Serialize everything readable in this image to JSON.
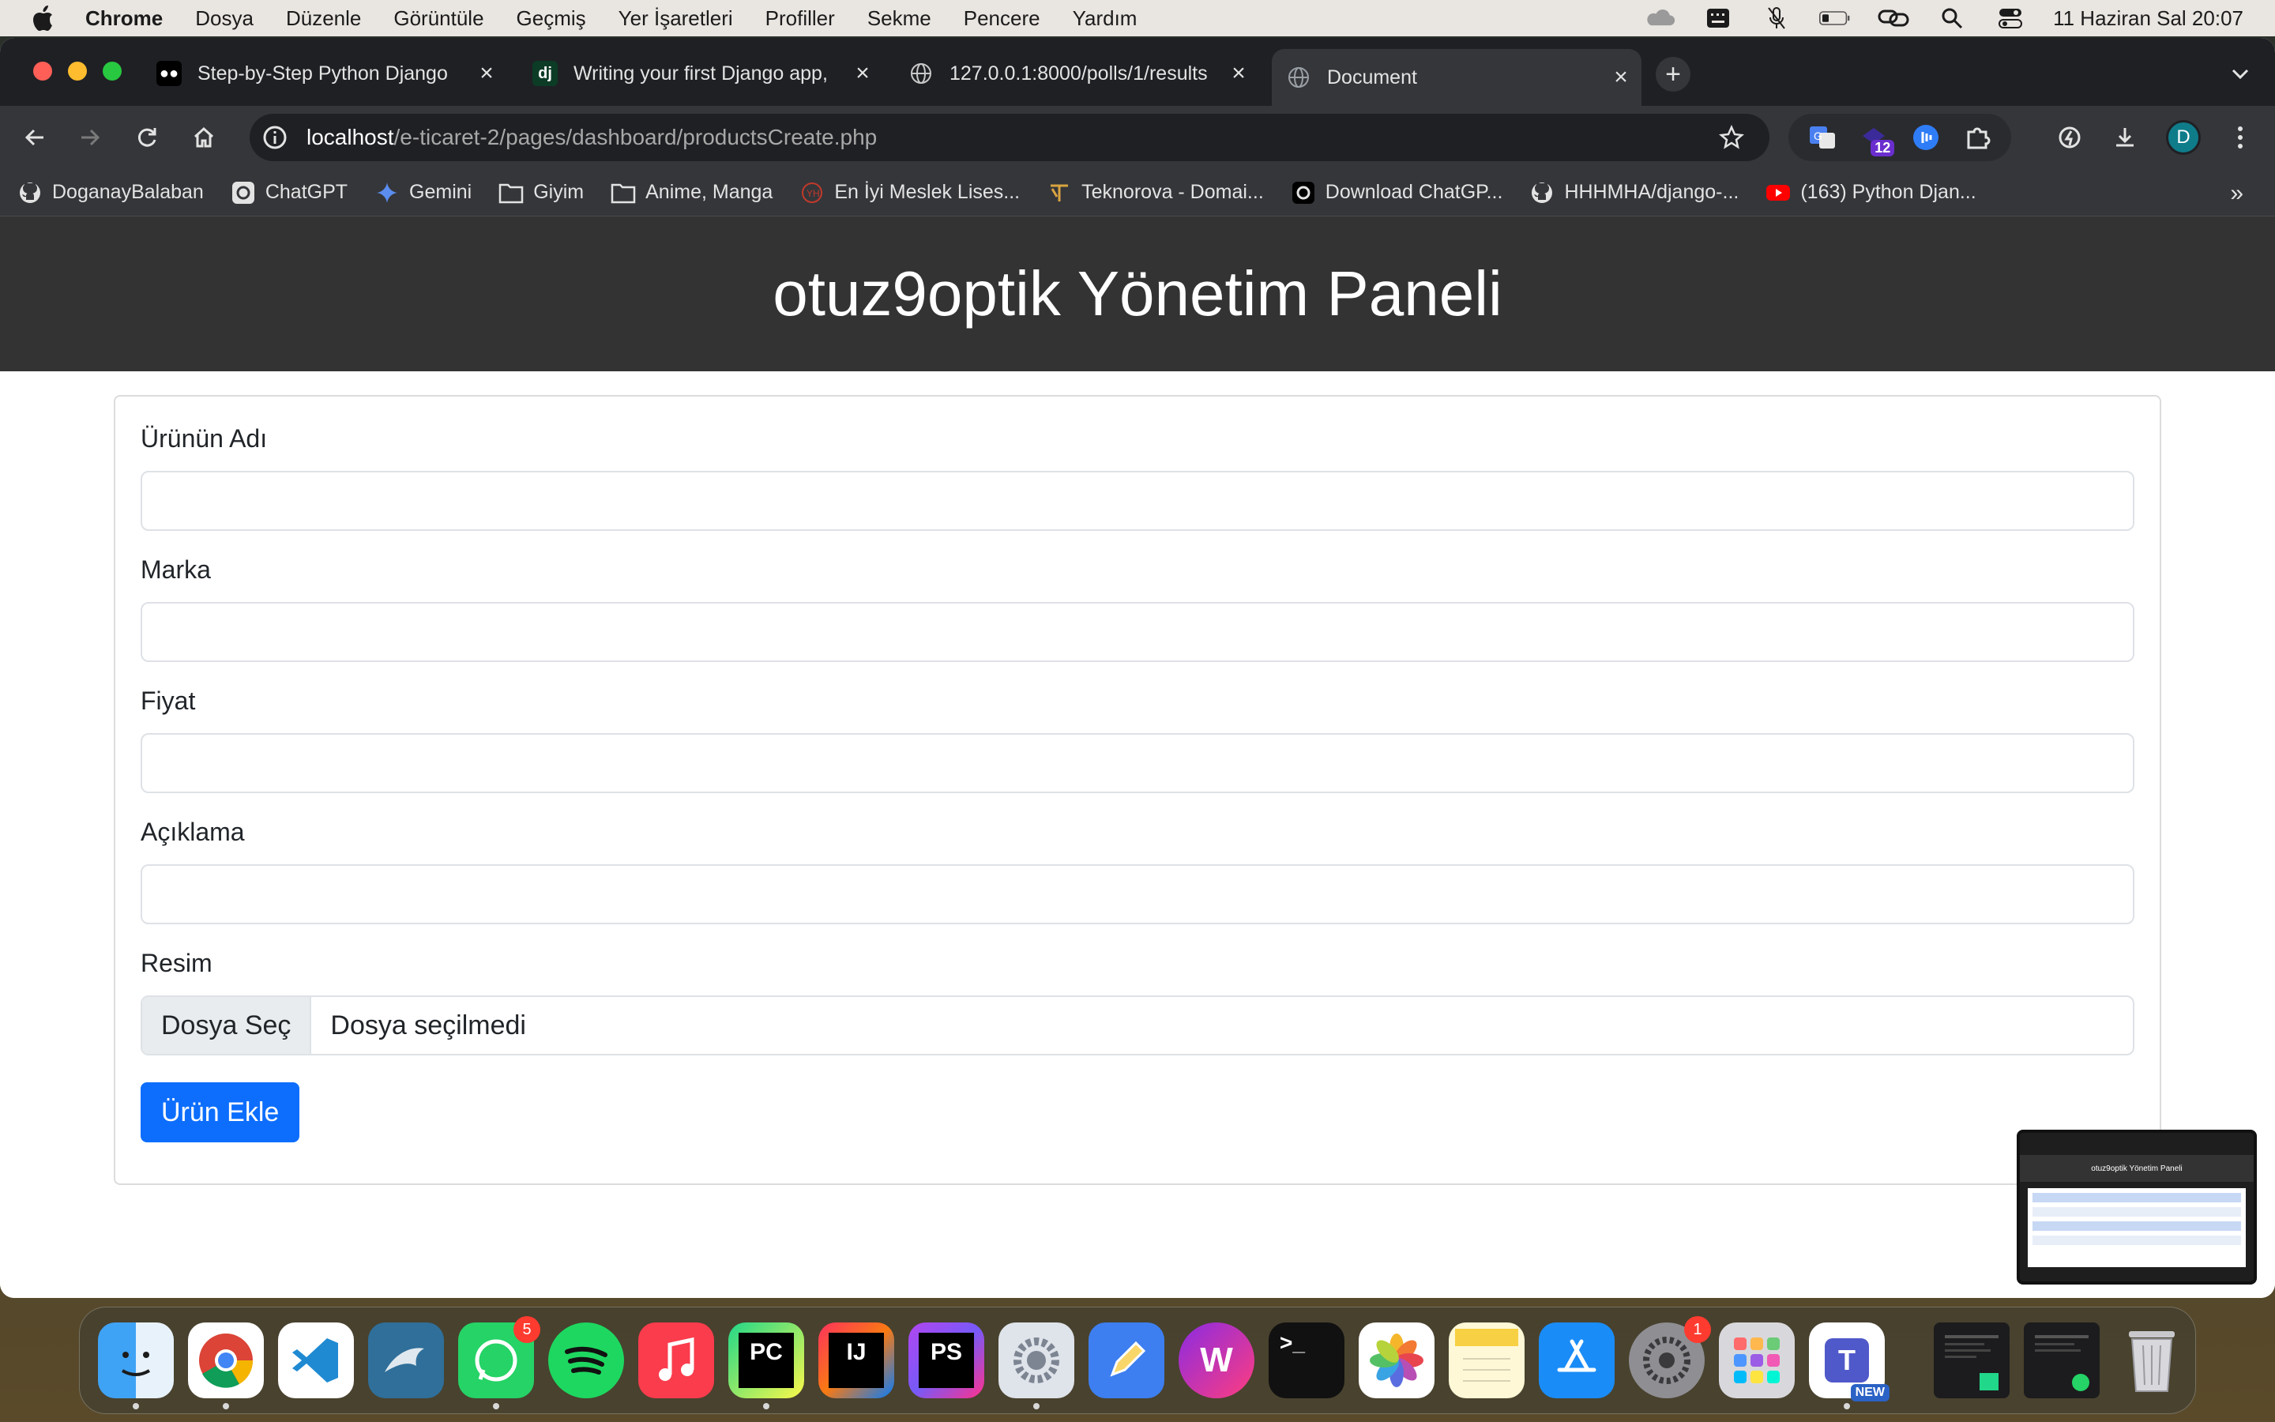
{
  "menubar": {
    "app_name": "Chrome",
    "items": [
      "Dosya",
      "Düzenle",
      "Görüntüle",
      "Geçmiş",
      "Yer İşaretleri",
      "Profiller",
      "Sekme",
      "Pencere",
      "Yardım"
    ],
    "clock": "11 Haziran Sal  20:07"
  },
  "tabs": [
    {
      "title": "Step-by-Step Python Django",
      "favicon": "medium-icon"
    },
    {
      "title": "Writing your first Django app,",
      "favicon": "django-icon"
    },
    {
      "title": "127.0.0.1:8000/polls/1/results",
      "favicon": "globe-icon"
    },
    {
      "title": "Document",
      "favicon": "globe-icon",
      "active": true
    }
  ],
  "address": {
    "host": "localhost",
    "path": "/e-ticaret-2/pages/dashboard/productsCreate.php"
  },
  "extensions": {
    "badge": "12"
  },
  "profile": {
    "initial": "D"
  },
  "bookmarks": [
    {
      "label": "DoganayBalaban",
      "icon": "github-icon"
    },
    {
      "label": "ChatGPT",
      "icon": "chatgpt-icon"
    },
    {
      "label": "Gemini",
      "icon": "gemini-icon"
    },
    {
      "label": "Giyim",
      "icon": "folder-icon"
    },
    {
      "label": "Anime, Manga",
      "icon": "folder-icon"
    },
    {
      "label": "En İyi Meslek Lises...",
      "icon": "site-icon"
    },
    {
      "label": "Teknorova - Domai...",
      "icon": "site-icon"
    },
    {
      "label": "Download ChatGP...",
      "icon": "chatgpt-icon"
    },
    {
      "label": "HHHMHA/django-...",
      "icon": "github-icon"
    },
    {
      "label": "(163) Python Djan...",
      "icon": "youtube-icon"
    }
  ],
  "page": {
    "header_title": "otuz9optik Yönetim Paneli",
    "form": {
      "name_label": "Ürünün Adı",
      "name_value": "",
      "brand_label": "Marka",
      "brand_value": "",
      "price_label": "Fiyat",
      "price_value": "",
      "description_label": "Açıklama",
      "description_value": "",
      "image_label": "Resim",
      "file_button": "Dosya Seç",
      "file_status": "Dosya seçilmedi",
      "submit_label": "Ürün Ekle"
    }
  },
  "pip": {
    "title": "otuz9optik Yönetim Paneli"
  },
  "dock": {
    "whatsapp_badge": "5",
    "settings_badge": "1",
    "teams_tag": "NEW"
  },
  "colors": {
    "header_bg": "#333333",
    "primary": "#0d6efd",
    "tab_bg": "#1f2024",
    "toolbar_bg": "#35363a"
  }
}
